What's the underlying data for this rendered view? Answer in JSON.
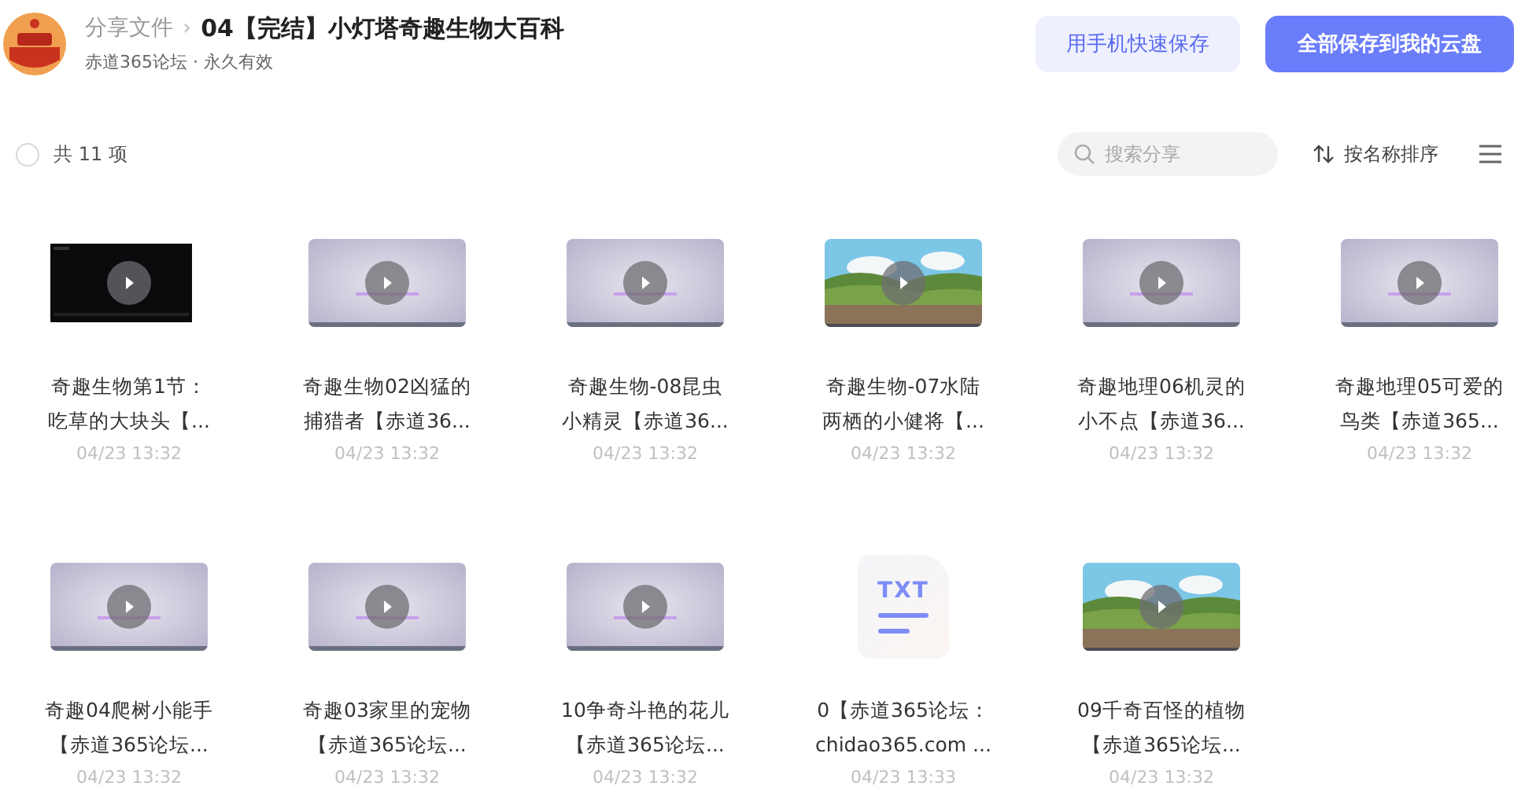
{
  "header": {
    "breadcrumb": "分享文件",
    "separator": "›",
    "title": "04【完结】小灯塔奇趣生物大百科",
    "owner": "赤道365论坛 · 永久有效",
    "buttons": [
      {
        "label": "用手机快速保存",
        "kind": "secondary"
      },
      {
        "label": "全部保存到我的云盘",
        "kind": "primary"
      }
    ]
  },
  "toolbar": {
    "select_all": {
      "checked": false
    },
    "count": "共 11 项",
    "search": {
      "placeholder": "搜索分享"
    },
    "sort": "按名称排序"
  },
  "files": [
    {
      "kind": "dark",
      "name_lines": [
        "奇趣生物第1节：",
        "吃草的大块头【..."
      ],
      "date": "04/23 13:32"
    },
    {
      "kind": "purple",
      "name_lines": [
        "奇趣生物02凶猛的",
        "捕猎者【赤道36..."
      ],
      "date": "04/23 13:32"
    },
    {
      "kind": "purple",
      "name_lines": [
        "奇趣生物-08昆虫",
        "小精灵【赤道36..."
      ],
      "date": "04/23 13:32"
    },
    {
      "kind": "landscape",
      "name_lines": [
        "奇趣生物-07水陆",
        "两栖的小健将【..."
      ],
      "date": "04/23 13:32"
    },
    {
      "kind": "purple",
      "name_lines": [
        "奇趣地理06机灵的",
        "小不点【赤道36..."
      ],
      "date": "04/23 13:32"
    },
    {
      "kind": "purple",
      "name_lines": [
        "奇趣地理05可爱的",
        "鸟类【赤道365..."
      ],
      "date": "04/23 13:32"
    },
    {
      "kind": "purple",
      "name_lines": [
        "奇趣04爬树小能手",
        "【赤道365论坛..."
      ],
      "date": "04/23 13:32"
    },
    {
      "kind": "purple",
      "name_lines": [
        "奇趣03家里的宠物",
        "【赤道365论坛..."
      ],
      "date": "04/23 13:32"
    },
    {
      "kind": "purple",
      "name_lines": [
        "10争奇斗艳的花儿",
        "【赤道365论坛..."
      ],
      "date": "04/23 13:32"
    },
    {
      "kind": "txt",
      "badge": "TXT",
      "name_lines": [
        "0【赤道365论坛：",
        "chidao365.com ..."
      ],
      "date": "04/23 13:33"
    },
    {
      "kind": "landscape",
      "name_lines": [
        "09千奇百怪的植物",
        "【赤道365论坛..."
      ],
      "date": "04/23 13:32"
    }
  ]
}
